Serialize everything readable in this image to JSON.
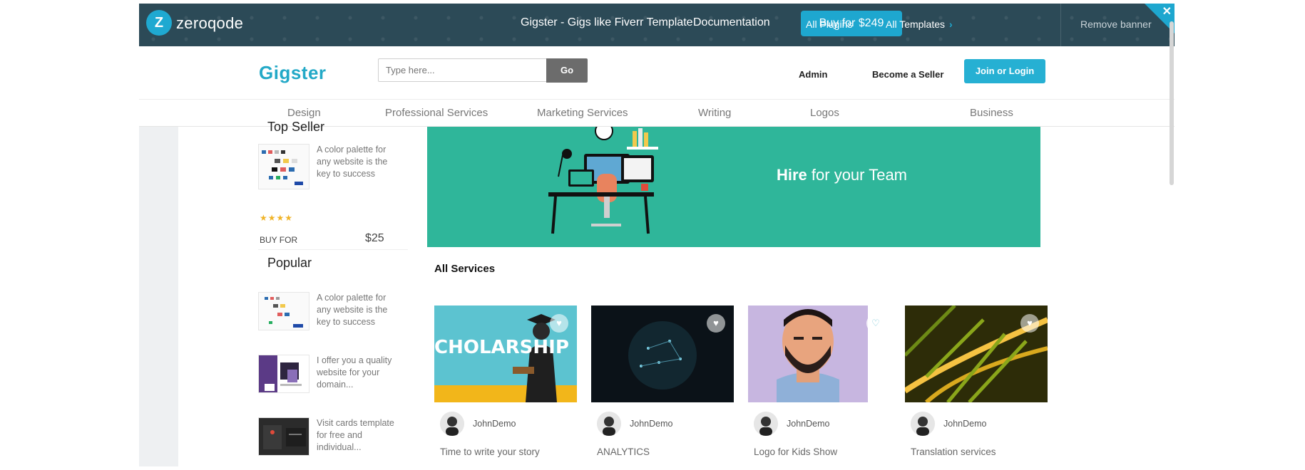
{
  "banner": {
    "brand": "zeroqode",
    "title": "Gigster - Gigs like Fiverr Template",
    "documentation": "Documentation",
    "buy_label": "Buy for $249",
    "all_plugins": "All Plugins",
    "all_templates": "All Templates",
    "remove_banner": "Remove banner",
    "close_glyph": "✕",
    "chevron_glyph": "›"
  },
  "header": {
    "logo": "Gigster",
    "search_placeholder": "Type here...",
    "go_label": "Go",
    "admin_label": "Admin",
    "become_seller_label": "Become a Seller",
    "join_label": "Join or Login"
  },
  "categories": [
    "Design",
    "Professional Services",
    "Marketing Services",
    "Writing",
    "Logos",
    "Business"
  ],
  "sidebar": {
    "top_seller_heading": "Top Seller",
    "top_seller_item": {
      "text": "A color palette for any website is the key to success",
      "rating": "★★★★",
      "buy_for": "BUY FOR",
      "price": "$25"
    },
    "popular_heading": "Popular",
    "popular_items": [
      {
        "text": "A color palette for any website is the key to success"
      },
      {
        "text": "I offer you a quality website for your domain..."
      },
      {
        "text": "Visit cards template for free and individual..."
      }
    ]
  },
  "hero": {
    "title_bold": "Hire",
    "title_rest": " for your Team"
  },
  "main": {
    "section_title": "All Services",
    "cards": [
      {
        "author": "JohnDemo",
        "title": "Time to write your story",
        "image_label": "CHOLARSHIP"
      },
      {
        "author": "JohnDemo",
        "title": "ANALYTICS"
      },
      {
        "author": "JohnDemo",
        "title": "Logo for Kids Show"
      },
      {
        "author": "JohnDemo",
        "title": "Translation services"
      }
    ]
  },
  "colors": {
    "banner_bg": "#2c4a57",
    "accent": "#1ea7cf",
    "hero_bg": "#2fb69a",
    "go_bg": "#6c6c6c"
  },
  "icons": [
    "zeroqode-logo-icon",
    "chevron-right-icon",
    "close-icon",
    "heart-icon",
    "avatar-icon",
    "palette-thumbnail-icon"
  ]
}
